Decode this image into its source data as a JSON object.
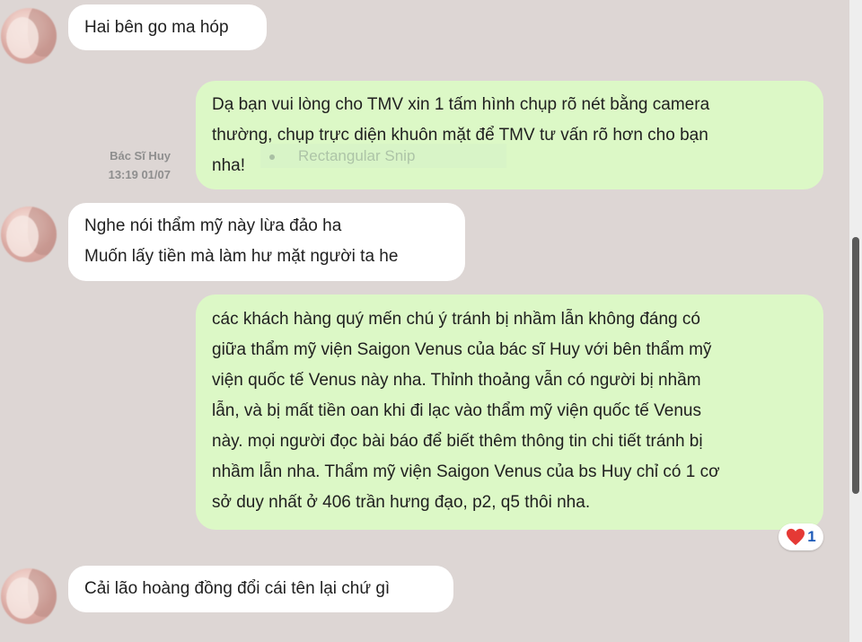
{
  "messages": [
    {
      "id": "m1",
      "direction": "incoming",
      "lines": [
        "Hai bên go ma hóp"
      ]
    },
    {
      "id": "m2",
      "direction": "outgoing",
      "sender": "Bác Sĩ Huy",
      "timestamp": "13:19 01/07",
      "lines": [
        "Dạ bạn vui lòng cho TMV xin 1 tấm hình chụp rõ nét bằng camera",
        "thường, chụp trực diện khuôn mặt để TMV tư vấn rõ hơn cho bạn",
        "nha!"
      ]
    },
    {
      "id": "m3",
      "direction": "incoming",
      "lines": [
        "Nghe nói thẩm mỹ này lừa đảo ha",
        "Muốn lấy tiền mà làm hư mặt người ta he"
      ]
    },
    {
      "id": "m4",
      "direction": "outgoing",
      "lines": [
        "các khách hàng quý mến chú ý tránh bị nhầm lẫn không đáng có",
        "giữa thẩm mỹ viện Saigon Venus của bác sĩ Huy với bên thẩm mỹ",
        "viện quốc tế Venus này nha. Thỉnh thoảng vẫn có người bị nhầm",
        "lẫn, và bị mất tiền oan khi đi lạc vào thẩm mỹ viện quốc tế Venus",
        "này. mọi người đọc bài báo để biết thêm thông tin chi tiết tránh bị",
        "nhầm lẫn nha. Thẩm mỹ viện Saigon Venus của bs Huy chỉ có 1 cơ",
        "sở duy nhất ở 406 trần hưng đạo, p2, q5 thôi nha."
      ],
      "reaction": {
        "icon": "heart-icon",
        "count": "1"
      }
    },
    {
      "id": "m5",
      "direction": "incoming",
      "lines": [
        "Cải lão hoàng đồng đổi cái tên lại chứ gì"
      ]
    }
  ],
  "snip_overlay": {
    "label": "Rectangular Snip"
  },
  "colors": {
    "background": "#ddd6d4",
    "incoming_bubble": "#ffffff",
    "outgoing_bubble": "#dcf8c6",
    "heart": "#e53935",
    "reaction_count": "#1e5bb8"
  }
}
